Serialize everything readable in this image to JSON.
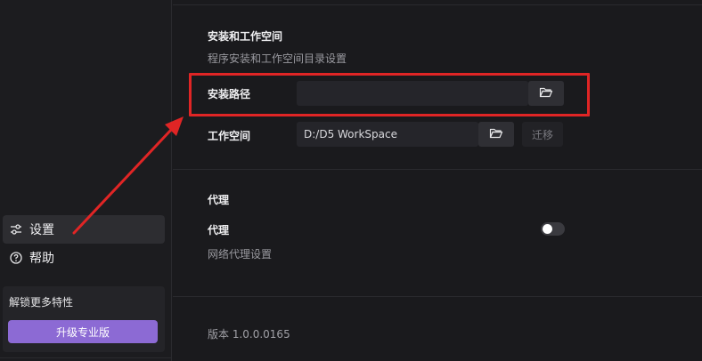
{
  "sidebar": {
    "items": [
      {
        "label": "设置",
        "icon": "sliders-icon",
        "active": true
      },
      {
        "label": "帮助",
        "icon": "help-circle-icon",
        "active": false
      }
    ],
    "upgrade": {
      "title": "解锁更多特性",
      "button_label": "升级专业版"
    }
  },
  "main": {
    "install_section": {
      "title": "安装和工作空间",
      "subtitle": "程序安装和工作空间目录设置",
      "install_path": {
        "label": "安装路径",
        "value": "",
        "icon": "folder-open-icon"
      },
      "workspace": {
        "label": "工作空间",
        "value": "D:/D5 WorkSpace",
        "icon": "folder-open-icon",
        "migrate_label": "迁移"
      }
    },
    "proxy_section": {
      "title": "代理",
      "proxy_label": "代理",
      "proxy_subtitle": "网络代理设置",
      "proxy_enabled": false
    },
    "version_text": "版本 1.0.0.0165"
  },
  "colors": {
    "background": "#1a1a1d",
    "accent": "#8c6ad4",
    "highlight": "#e02525"
  }
}
